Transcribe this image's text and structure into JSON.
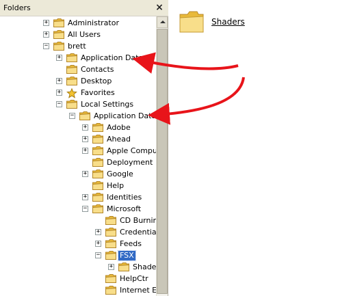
{
  "pane": {
    "title": "Folders",
    "close_symbol": "×"
  },
  "tree": [
    {
      "label": "Administrator",
      "depth": 0,
      "toggle": "+"
    },
    {
      "label": "All Users",
      "depth": 0,
      "toggle": "+"
    },
    {
      "label": "brett",
      "depth": 0,
      "toggle": "−"
    },
    {
      "label": "Application Data",
      "depth": 1,
      "toggle": "+"
    },
    {
      "label": "Contacts",
      "depth": 1,
      "toggle": ""
    },
    {
      "label": "Desktop",
      "depth": 1,
      "toggle": "+"
    },
    {
      "label": "Favorites",
      "depth": 1,
      "toggle": "+",
      "icon": "star"
    },
    {
      "label": "Local Settings",
      "depth": 1,
      "toggle": "−"
    },
    {
      "label": "Application Data",
      "depth": 2,
      "toggle": "−"
    },
    {
      "label": "Adobe",
      "depth": 3,
      "toggle": "+"
    },
    {
      "label": "Ahead",
      "depth": 3,
      "toggle": "+"
    },
    {
      "label": "Apple Computer",
      "depth": 3,
      "toggle": "+"
    },
    {
      "label": "Deployment",
      "depth": 3,
      "toggle": ""
    },
    {
      "label": "Google",
      "depth": 3,
      "toggle": "+"
    },
    {
      "label": "Help",
      "depth": 3,
      "toggle": ""
    },
    {
      "label": "Identities",
      "depth": 3,
      "toggle": "+"
    },
    {
      "label": "Microsoft",
      "depth": 3,
      "toggle": "−"
    },
    {
      "label": "CD Burning",
      "depth": 4,
      "toggle": ""
    },
    {
      "label": "Credentials",
      "depth": 4,
      "toggle": "+"
    },
    {
      "label": "Feeds",
      "depth": 4,
      "toggle": "+"
    },
    {
      "label": "FSX",
      "depth": 4,
      "toggle": "−",
      "selected": true
    },
    {
      "label": "Shaders",
      "depth": 5,
      "toggle": "+"
    },
    {
      "label": "HelpCtr",
      "depth": 4,
      "toggle": ""
    },
    {
      "label": "Internet Explorer",
      "depth": 4,
      "toggle": ""
    }
  ],
  "content": {
    "items": [
      {
        "label": "Shaders",
        "icon": "folder-icon"
      }
    ]
  },
  "colors": {
    "selection": "#316ac5",
    "arrow": "#e8141a",
    "folder": "#f5d874"
  }
}
